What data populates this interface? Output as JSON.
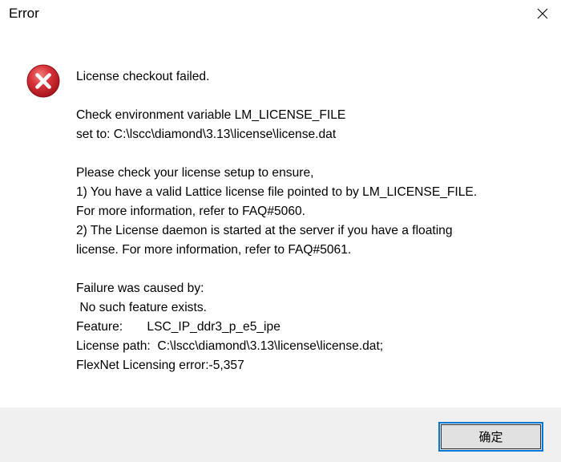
{
  "window": {
    "title": "Error"
  },
  "icons": {
    "error": "error-icon",
    "close": "close-icon"
  },
  "colors": {
    "error_red": "#d0262b",
    "button_focus_border": "#0078d7",
    "footer_bg": "#f0f0f0"
  },
  "message": {
    "heading": "License checkout failed.",
    "env_line_1": "Check environment variable LM_LICENSE_FILE",
    "env_line_2": "set to: C:\\lscc\\diamond\\3.13\\license\\license.dat",
    "check_line_1": "Please check your license setup to ensure,",
    "check_line_2": "1) You have a valid Lattice license file pointed to by LM_LICENSE_FILE.",
    "check_line_3": "For more information, refer to FAQ#5060.",
    "check_line_4": "2) The License daemon is started at the server if you have a floating",
    "check_line_5": "license. For more information, refer to FAQ#5061.",
    "failure_line_1": "Failure was caused by:",
    "failure_line_2": " No such feature exists.",
    "failure_line_3": "Feature:       LSC_IP_ddr3_p_e5_ipe",
    "failure_line_4": "License path:  C:\\lscc\\diamond\\3.13\\license\\license.dat;",
    "failure_line_5": "FlexNet Licensing error:-5,357"
  },
  "buttons": {
    "ok_label": "确定"
  }
}
